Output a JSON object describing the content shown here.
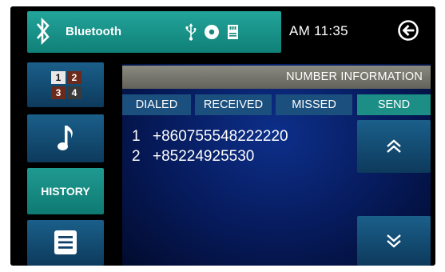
{
  "status_bar": {
    "bluetooth_label": "Bluetooth",
    "bluetooth_icon": "bluetooth-icon",
    "status_icons": [
      "usb-icon",
      "disc-icon",
      "sd-card-icon"
    ],
    "clock": "AM 11:35",
    "back_icon": "back-arrow-icon"
  },
  "sidebar": {
    "keypad_keys": [
      "1",
      "2",
      "3",
      "4"
    ],
    "music_icon": "music-note-icon",
    "history_label": "HISTORY",
    "menu_icon": "list-menu-icon"
  },
  "panel": {
    "title": "NUMBER INFORMATION",
    "tabs": {
      "dialed": "DIALED",
      "received": "RECEIVED",
      "missed": "MISSED",
      "send": "SEND"
    },
    "calls": [
      {
        "index": "1",
        "number": "+860755548222220"
      },
      {
        "index": "2",
        "number": "+85224925530"
      }
    ],
    "scroll_up_icon": "chevron-up-double-icon",
    "scroll_down_icon": "chevron-down-double-icon"
  },
  "colors": {
    "teal_active": "#1f9a91",
    "blue_button": "#1a5f8a",
    "header_grey": "#7a7a70",
    "panel_blue": "#0d2f8a"
  }
}
